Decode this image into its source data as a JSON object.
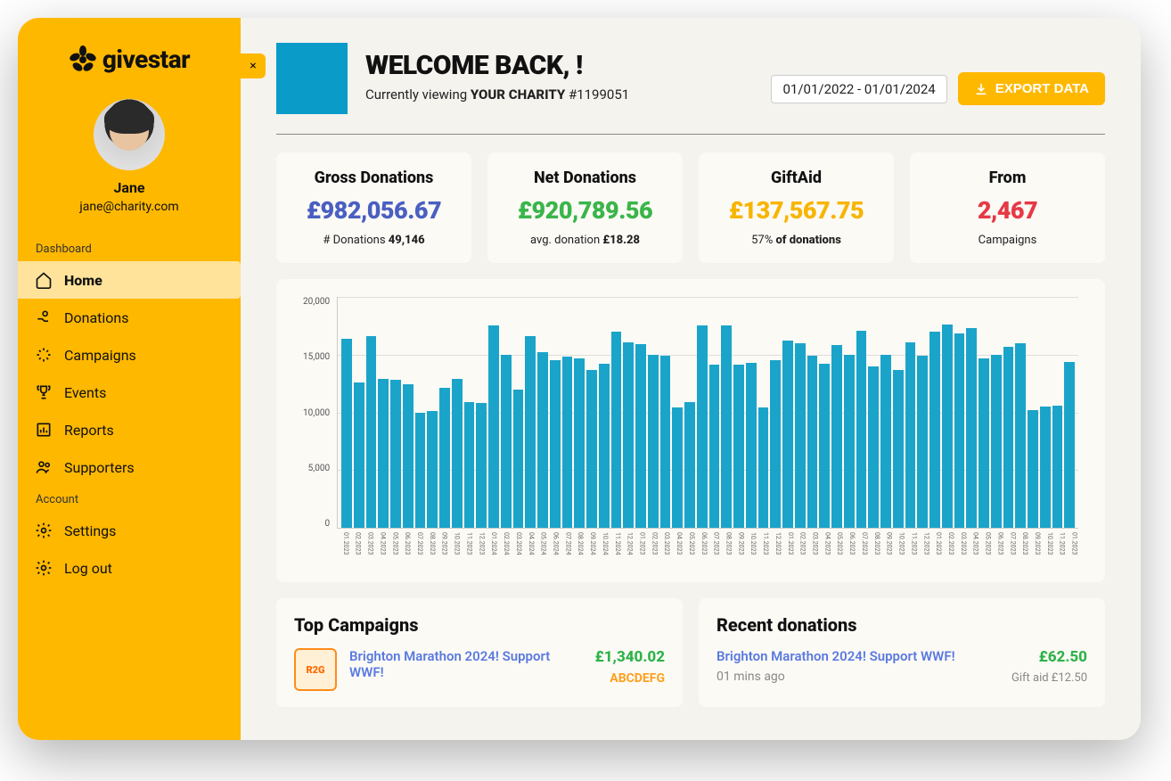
{
  "brand": "givestar",
  "sidebar": {
    "close_label": "×",
    "profile": {
      "name": "Jane",
      "email": "jane@charity.com"
    },
    "sections": {
      "dashboard_label": "Dashboard",
      "account_label": "Account"
    },
    "items": {
      "home": "Home",
      "donations": "Donations",
      "campaigns": "Campaigns",
      "events": "Events",
      "reports": "Reports",
      "supporters": "Supporters",
      "settings": "Settings",
      "logout": "Log out"
    }
  },
  "header": {
    "welcome": "WELCOME BACK, !",
    "sub_prefix": "Currently viewing ",
    "sub_bold": "YOUR CHARITY",
    "sub_id": " #1199051",
    "date_range": "01/01/2022 - 01/01/2024",
    "export_label": "EXPORT DATA"
  },
  "stats": {
    "gross": {
      "title": "Gross Donations",
      "value": "£982,056.67",
      "sub_prefix": "# Donations ",
      "sub_bold": "49,146"
    },
    "net": {
      "title": "Net Donations",
      "value": "£920,789.56",
      "sub_prefix": "avg. donation ",
      "sub_bold": "£18.28"
    },
    "giftaid": {
      "title": "GiftAid",
      "value": "£137,567.75",
      "sub_prefix": "57% ",
      "sub_bold": "of donations"
    },
    "from": {
      "title": "From",
      "value": "2,467",
      "sub": "Campaigns"
    }
  },
  "chart_data": {
    "type": "bar",
    "title": "",
    "xlabel": "",
    "ylabel": "",
    "ylim": [
      0,
      20000
    ],
    "y_ticks": [
      "20,000",
      "15,000",
      "10,000",
      "5,000",
      "0"
    ],
    "categories": [
      "01.2023",
      "02.2023",
      "03.2023",
      "04.2023",
      "05.2023",
      "06.2023",
      "07.2023",
      "08.2023",
      "09.2023",
      "10.2023",
      "11.2023",
      "12.2023",
      "01.2024",
      "02.2024",
      "03.2024",
      "04.2024",
      "05.2024",
      "06.2024",
      "07.2024",
      "08.2024",
      "09.2024",
      "10.2024",
      "11.2024",
      "12.2024",
      "01.2023",
      "02.2023",
      "03.2023",
      "04.2023",
      "05.2023",
      "06.2023",
      "07.2023",
      "08.2023",
      "09.2023",
      "10.2023",
      "11.2023",
      "12.2023",
      "01.2023",
      "02.2023",
      "03.2023",
      "04.2023",
      "05.2023",
      "06.2023",
      "07.2023",
      "08.2023",
      "09.2023",
      "10.2023",
      "11.2023",
      "12.2023",
      "01.2023",
      "02.2023",
      "03.2023",
      "04.2023",
      "05.2023",
      "06.2023",
      "07.2023",
      "08.2023",
      "09.2023",
      "10.2023",
      "11.2023",
      "01.2023"
    ],
    "values": [
      16400,
      12600,
      16600,
      12900,
      12800,
      12400,
      10000,
      10100,
      12100,
      12900,
      10900,
      10800,
      17500,
      15000,
      12000,
      16600,
      15200,
      14500,
      14800,
      14700,
      13700,
      14200,
      17000,
      16100,
      15900,
      15000,
      14900,
      10400,
      10900,
      17500,
      14100,
      17500,
      14100,
      14300,
      10400,
      14500,
      16200,
      16000,
      14900,
      14200,
      15800,
      15000,
      17100,
      14000,
      15000,
      13700,
      16100,
      14900,
      17000,
      17600,
      16800,
      17300,
      14700,
      15000,
      15700,
      16000,
      10200,
      10500,
      10600,
      14400
    ]
  },
  "top_campaigns": {
    "title": "Top Campaigns",
    "items": [
      {
        "badge": "R2G",
        "name": "Brighton Marathon 2024! Support WWF!",
        "amount": "£1,340.02",
        "code": "ABCDEFG"
      }
    ]
  },
  "recent_donations": {
    "title": "Recent donations",
    "items": [
      {
        "name": "Brighton Marathon 2024! Support WWF!",
        "time": "01 mins ago",
        "amount": "£62.50",
        "giftaid": "Gift aid £12.50"
      }
    ]
  }
}
